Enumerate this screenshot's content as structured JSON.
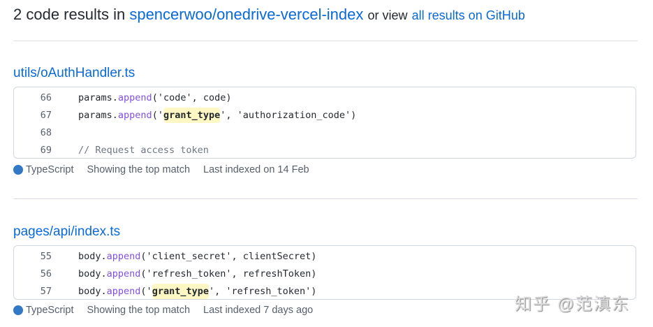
{
  "header": {
    "count_text": "2 code results in",
    "repo": "spencerwoo/onedrive-vercel-index",
    "or_view": "or view",
    "all_results": "all results on GitHub"
  },
  "results": [
    {
      "file": "utils/oAuthHandler.ts",
      "lines": [
        {
          "num": "66",
          "pre": "params.",
          "fn": "append",
          "mid": "('code', code)",
          "hl": "",
          "post": ""
        },
        {
          "num": "67",
          "pre": "params.",
          "fn": "append",
          "mid": "('",
          "hl": "grant_type",
          "post": "', 'authorization_code')"
        },
        {
          "num": "68",
          "pre": "",
          "fn": "",
          "mid": "",
          "hl": "",
          "post": ""
        },
        {
          "num": "69",
          "comment": "// Request access token"
        }
      ],
      "language": "TypeScript",
      "match": "Showing the top match",
      "indexed": "Last indexed on 14 Feb"
    },
    {
      "file": "pages/api/index.ts",
      "lines": [
        {
          "num": "55",
          "pre": "body.",
          "fn": "append",
          "mid": "('client_secret', clientSecret)",
          "hl": "",
          "post": ""
        },
        {
          "num": "56",
          "pre": "body.",
          "fn": "append",
          "mid": "('refresh_token', refreshToken)",
          "hl": "",
          "post": ""
        },
        {
          "num": "57",
          "pre": "body.",
          "fn": "append",
          "mid": "('",
          "hl": "grant_type",
          "post": "', 'refresh_token')"
        }
      ],
      "language": "TypeScript",
      "match": "Showing the top match",
      "indexed": "Last indexed 7 days ago"
    }
  ],
  "colors": {
    "link": "#0969da",
    "typescript": "#3178c6",
    "highlight": "#fff8c5"
  },
  "watermark": "知乎 @范滇东"
}
